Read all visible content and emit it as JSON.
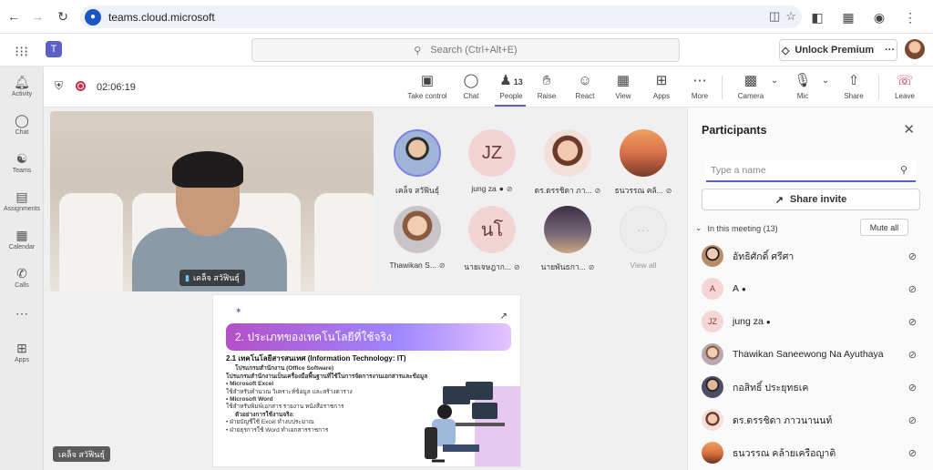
{
  "browser": {
    "url": "teams.cloud.microsoft",
    "icons": [
      "back-icon",
      "forward-icon",
      "reload-icon",
      "site-info-icon",
      "install-icon",
      "star-icon",
      "extensions-icon",
      "sidebar-icon",
      "profile-icon",
      "menu-icon"
    ]
  },
  "teams_header": {
    "search_placeholder": "Search (Ctrl+Alt+E)",
    "premium_label": "Unlock Premium",
    "more": "···"
  },
  "rail": [
    {
      "label": "Activity",
      "icon": "bell-icon"
    },
    {
      "label": "Chat",
      "icon": "chat-icon"
    },
    {
      "label": "Teams",
      "icon": "teams-icon"
    },
    {
      "label": "Assignments",
      "icon": "assignments-icon"
    },
    {
      "label": "Calendar",
      "icon": "calendar-icon"
    },
    {
      "label": "Calls",
      "icon": "phone-icon"
    },
    {
      "label": "",
      "icon": "more-icon"
    },
    {
      "label": "Apps",
      "icon": "apps-icon"
    }
  ],
  "meeting": {
    "timer": "02:06:19",
    "toolbar": {
      "take_control": "Take control",
      "chat": "Chat",
      "people": "People",
      "people_count": "13",
      "raise": "Raise",
      "react": "React",
      "view": "View",
      "apps": "Apps",
      "more": "More",
      "camera": "Camera",
      "mic": "Mic",
      "share": "Share",
      "leave": "Leave"
    },
    "speaker_name": "เคล็จ สวัฟินธุ์",
    "gallery": [
      {
        "name": "เคล็จ สวัฟินธุ์",
        "initials": "",
        "mic_off": false,
        "color": "#9fb4d6"
      },
      {
        "name": "jung za",
        "initials": "JZ",
        "mic_off": true,
        "color": "#f3d4d4"
      },
      {
        "name": "ดร.ดรรชิดา ภา...",
        "initials": "",
        "mic_off": true,
        "color": "#e9b9a0"
      },
      {
        "name": "ธนวรรณ คล้...",
        "initials": "",
        "mic_off": true,
        "color": "#d9704a"
      },
      {
        "name": "Thawikan S...",
        "initials": "",
        "mic_off": true,
        "color": "#c8c4c8"
      },
      {
        "name": "นายเจษฎาก...",
        "initials": "นโ",
        "mic_off": true,
        "color": "#f3d4d4"
      },
      {
        "name": "นายพันธกา...",
        "initials": "",
        "mic_off": true,
        "color": "#7a6a78"
      },
      {
        "name": "View all",
        "initials": "···",
        "mic_off": false,
        "color": "#ececec"
      }
    ],
    "share": {
      "presenter": "เคล็จ สวัฟินธุ์",
      "slide_title": "2. ประเภทของเทคโนโลยีที่ใช้จริง",
      "heading": "2.1 เทคโนโลยีสารสนเทศ (Information Technology: IT)",
      "lines": [
        "โปรแกรมสำนักงาน (Office Software)",
        "โปรแกรมสำนักงานเป็นเครื่องมือพื้นฐานที่ใช้ในการจัดการงานเอกสารและข้อมูล",
        "• Microsoft Excel",
        "ใช้สำหรับคำนวณ วิเคราะห์ข้อมูล และสร้างตาราง",
        "• Microsoft Word",
        "ใช้สำหรับพิมพ์เอกสาร รายงาน หนังสือราชการ",
        "ตัวอย่างการใช้งานจริง:",
        "• ฝ่ายบัญชีใช้ Excel ทำงบประมาณ",
        "• ฝ่ายธุรการใช้ Word ทำเอกสารราชการ"
      ]
    }
  },
  "panel": {
    "title": "Participants",
    "search_placeholder": "Type a name",
    "share_invite": "Share invite",
    "in_meeting": "In this meeting (13)",
    "mute_all": "Mute all",
    "participants": [
      {
        "name": "อัทธิศักดิ์ ศรีศา",
        "initials": "",
        "color": "#b78d6a",
        "badge": false
      },
      {
        "name": "A",
        "initials": "A",
        "color": "#f5d5d5",
        "badge": true
      },
      {
        "name": "jung za",
        "initials": "JZ",
        "color": "#f5d5d5",
        "badge": true
      },
      {
        "name": "Thawikan Saneewong Na Ayuthaya",
        "initials": "",
        "color": "#b9a8b3",
        "badge": false
      },
      {
        "name": "กอสิทธิ์ ประยุทธเค",
        "initials": "",
        "color": "#4a4f63",
        "badge": false
      },
      {
        "name": "ดร.ดรรชิดา ภาวนานนท์",
        "initials": "",
        "color": "#e4a07e",
        "badge": false
      },
      {
        "name": "ธนวรรณ คล้ายเครือญาติ",
        "initials": "",
        "color": "#d4703f",
        "badge": false
      }
    ]
  }
}
